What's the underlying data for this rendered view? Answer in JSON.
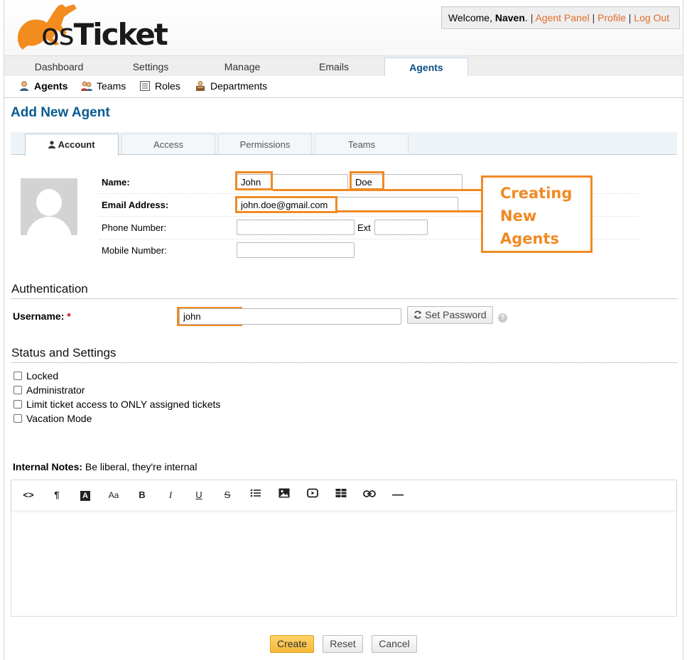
{
  "header": {
    "logo_text_os": "os",
    "logo_text_ticket": "Ticket",
    "welcome_prefix": "Welcome, ",
    "user_name": "Naven",
    "welcome_suffix": ".",
    "links": [
      "Agent Panel",
      "Profile",
      "Log Out"
    ],
    "separator": "|"
  },
  "nav": {
    "tabs": [
      "Dashboard",
      "Settings",
      "Manage",
      "Emails",
      "Agents"
    ],
    "active": "Agents"
  },
  "subnav": {
    "items": [
      "Agents",
      "Teams",
      "Roles",
      "Departments"
    ]
  },
  "page_title": "Add New Agent",
  "form_tabs": [
    "Account",
    "Access",
    "Permissions",
    "Teams"
  ],
  "account": {
    "name_label": "Name:",
    "first_name": "John",
    "last_name": "Doe",
    "email_label": "Email Address:",
    "email": "john.doe@gmail.com",
    "phone_label": "Phone Number:",
    "phone": "",
    "ext_label": "Ext",
    "ext": "",
    "mobile_label": "Mobile Number:",
    "mobile": ""
  },
  "callout": [
    "Creating",
    "New",
    "Agents"
  ],
  "authentication": {
    "title": "Authentication",
    "username_label": "Username:",
    "required_mark": "*",
    "username": "john",
    "set_password": "Set Password",
    "help": "?"
  },
  "status": {
    "title": "Status and Settings",
    "options": [
      "Locked",
      "Administrator",
      "Limit ticket access to ONLY assigned tickets",
      "Vacation Mode"
    ]
  },
  "notes": {
    "label": "Internal Notes:",
    "hint": "Be liberal, they're internal"
  },
  "editor_toolbar": [
    "<>",
    "¶",
    "A",
    "Aa",
    "B",
    "I",
    "U",
    "S",
    "list-icon",
    "image-icon",
    "video-icon",
    "table-icon",
    "link-icon",
    "—"
  ],
  "buttons": {
    "create": "Create",
    "reset": "Reset",
    "cancel": "Cancel"
  },
  "colors": {
    "accent": "#e36c2c",
    "highlight": "#f08a24",
    "title_blue": "#0a5a92"
  }
}
